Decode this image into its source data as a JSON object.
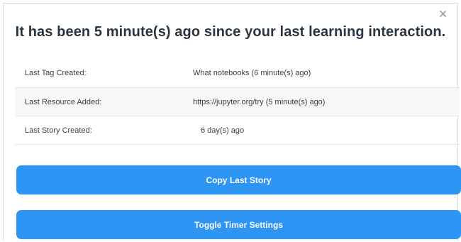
{
  "dialog": {
    "title": "It has been 5 minute(s) ago since your last learning interaction.",
    "close_icon": "close-icon"
  },
  "info_rows": [
    {
      "label": "Last Tag Created:",
      "value": "What notebooks (6 minute(s) ago)"
    },
    {
      "label": "Last Resource Added:",
      "value": "https://jupyter.org/try (5 minute(s) ago)"
    },
    {
      "label": "Last Story Created:",
      "value": "6 day(s) ago"
    }
  ],
  "buttons": {
    "copy_label": "Copy Last Story",
    "toggle_label": "Toggle Timer Settings"
  },
  "colors": {
    "accent": "#2d96f5",
    "title": "#2a3540",
    "text": "#3a3f44",
    "row_shade": "#f6f7f8"
  }
}
